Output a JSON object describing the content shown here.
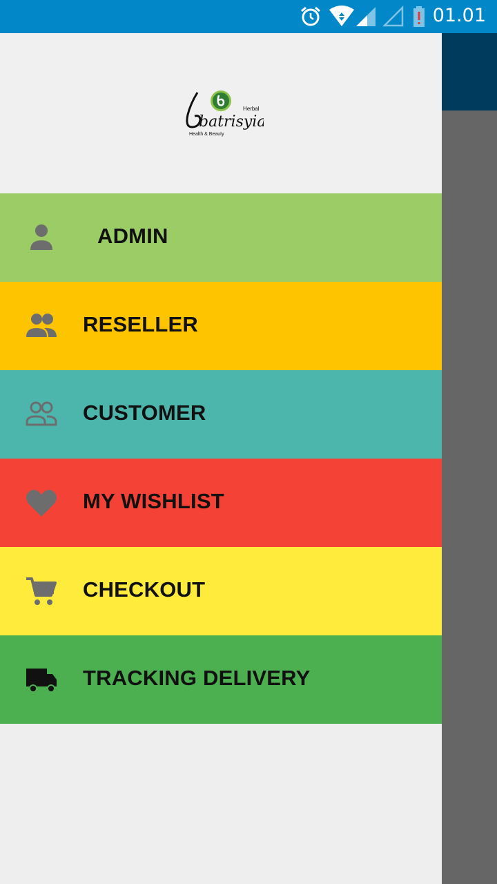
{
  "status_bar": {
    "time": "01.01",
    "icons": [
      "alarm-icon",
      "wifi-icon",
      "signal-icon",
      "signal-empty-icon",
      "battery-alert-icon"
    ]
  },
  "drawer": {
    "logo": {
      "brand": "batrisyia",
      "tag_top": "Herbal",
      "tag_bottom": "Health & Beauty"
    },
    "menu": [
      {
        "label": "ADMIN",
        "icon": "person-icon",
        "color": "#9ccc65"
      },
      {
        "label": "RESELLER",
        "icon": "group-icon",
        "color": "#ffc400"
      },
      {
        "label": "CUSTOMER",
        "icon": "group-outline-icon",
        "color": "#4db6ac"
      },
      {
        "label": "MY WISHLIST",
        "icon": "heart-icon",
        "color": "#f44336"
      },
      {
        "label": "CHECKOUT",
        "icon": "cart-icon",
        "color": "#ffeb3b"
      },
      {
        "label": "TRACKING DELIVERY",
        "icon": "truck-icon",
        "color": "#4caf50"
      }
    ]
  },
  "colors": {
    "status_bar": "#0288c8",
    "toolbar": "#003a5c",
    "scrim": "#666666",
    "drawer_bg": "#eeeeee"
  }
}
